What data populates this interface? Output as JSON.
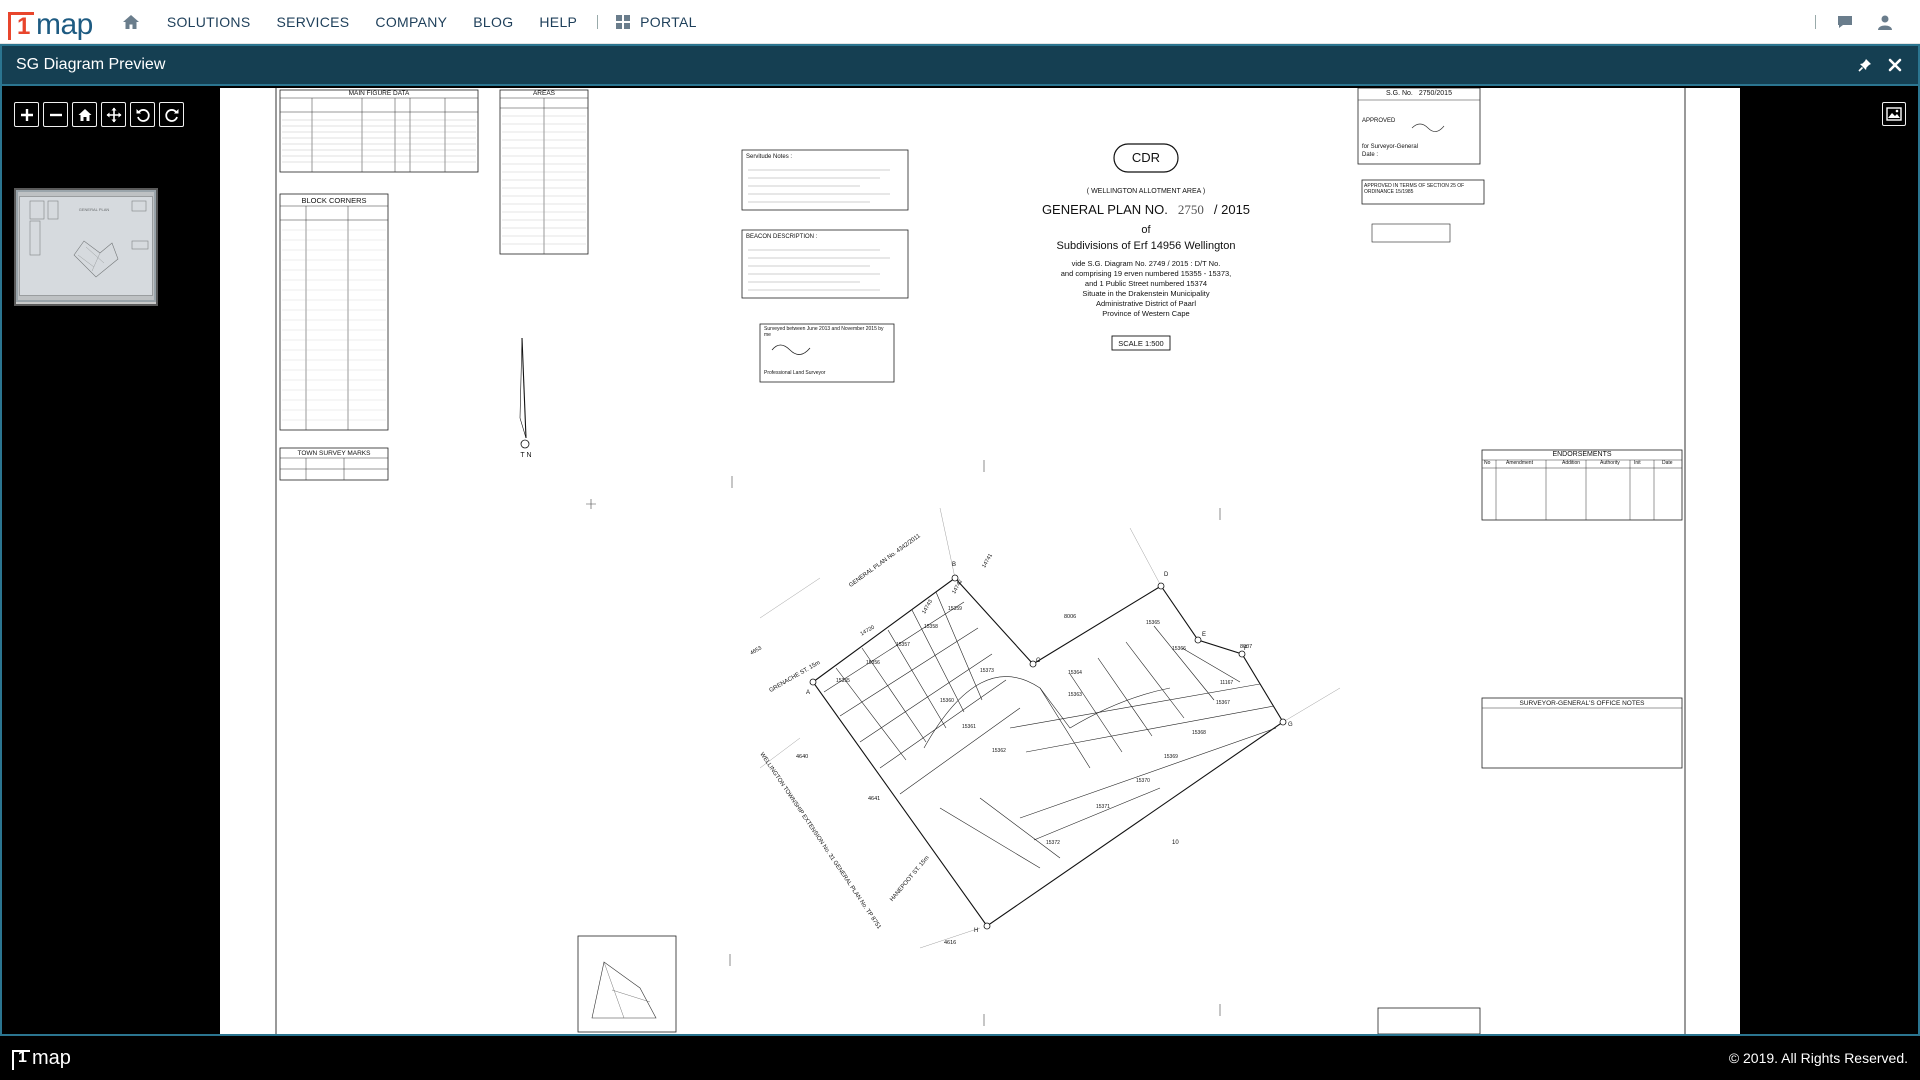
{
  "brand": {
    "logo_one": "1",
    "logo_text": "map",
    "accent": "#e8452c",
    "primary": "#1e5b82"
  },
  "nav": {
    "home_icon": "home-icon",
    "items": [
      {
        "label": "SOLUTIONS"
      },
      {
        "label": "SERVICES"
      },
      {
        "label": "COMPANY"
      },
      {
        "label": "BLOG"
      },
      {
        "label": "HELP"
      }
    ],
    "portal": "PORTAL",
    "right_icons": [
      "chat-icon",
      "user-icon"
    ]
  },
  "modal": {
    "title": "SG Diagram Preview",
    "header_color": "#153f52",
    "actions": [
      "pin-icon",
      "close-icon"
    ]
  },
  "viewer": {
    "tools": [
      "zoom-in-icon",
      "zoom-out-icon",
      "home-icon",
      "fullpage-icon",
      "rotate-left-icon",
      "rotate-right-icon"
    ],
    "image_toggle": "image-icon"
  },
  "plan": {
    "stamp": "CDR",
    "area": "( WELLINGTON ALLOTMENT AREA )",
    "general_plan_label": "GENERAL PLAN NO.",
    "general_plan_no": "2750",
    "general_plan_year": "/ 2015",
    "of": "of",
    "subdivisions": "Subdivisions of Erf 14956 Wellington",
    "vide": "vide S.G. Diagram No. 2749 / 2015 : D/T No.",
    "comprising": "and comprising 19 erven numbered 15355 - 15373,",
    "street": "and 1 Public Street numbered 15374",
    "situate": "Situate in the Drakenstein Municipality",
    "district": "Administrative District of Paarl",
    "province": "Province of Western Cape",
    "scale": "SCALE 1:500",
    "sg_no_label": "S.G. No.",
    "sg_no_value": "2750/2015",
    "approved": "APPROVED",
    "for_sg": "for Surveyor-General",
    "date_label": "Date :",
    "approved_terms": "APPROVED IN TERMS OF SECTION 25 OF ORDINANCE 15/1985",
    "main_figure": "MAIN FIGURE DATA",
    "block_corners": "BLOCK CORNERS",
    "town_survey_marks": "TOWN SURVEY MARKS",
    "areas": "AREAS",
    "servitude_notes": "Servitude Notes :",
    "beacon_description": "BEACON DESCRIPTION :",
    "surveyed": "Surveyed between June 2013 and November 2015 by me",
    "professional": "Professional Land Surveyor",
    "endorsements": "ENDORSEMENTS",
    "endorsement_cols": [
      "No",
      "Amendment",
      "Addition",
      "Authority",
      "Init",
      "Date"
    ],
    "sg_office_notes": "SURVEYOR-GENERAL'S OFFICE NOTES",
    "north": "T N",
    "street_labels": [
      "GRENACHE ST. 15m",
      "HANEPOOT ST. 15m",
      "WELLINGTON TOWNSHIP EXTENSION No. 31 GENERAL PLAN No. TP 8751",
      "GENERAL PLAN No. 4342/2011"
    ],
    "erf_labels": [
      "15355",
      "15356",
      "15357",
      "15358",
      "15359",
      "15360",
      "15361",
      "15362",
      "15363",
      "15364",
      "15365",
      "15366",
      "15367",
      "15368",
      "15369",
      "15370",
      "15371",
      "15372",
      "15373",
      "4641",
      "4640",
      "4616",
      "8006",
      "8007",
      "14741",
      "14742",
      "14743",
      "14720",
      "4653",
      "10",
      "11167"
    ],
    "corners": [
      "A",
      "B",
      "C",
      "D",
      "E",
      "F",
      "G",
      "H"
    ]
  },
  "footer": {
    "logo_one": "1",
    "logo_text": "map",
    "copyright": "© 2019. All Rights Reserved."
  }
}
